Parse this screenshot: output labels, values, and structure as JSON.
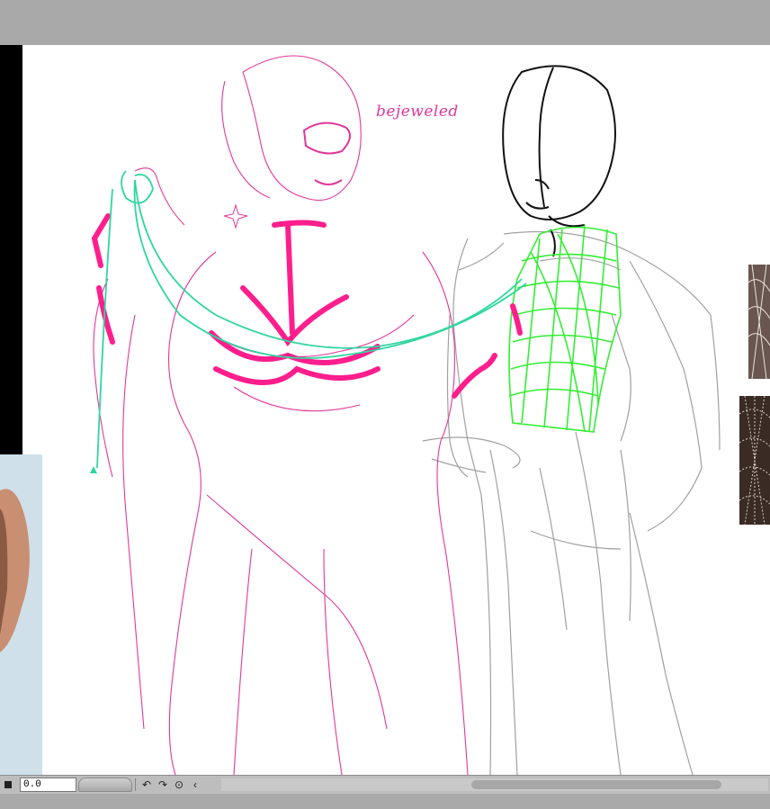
{
  "canvas": {
    "annotation_text": "bejeweled",
    "colors": {
      "background": "#ffffff",
      "pink_sketch": "#e0389a",
      "pink_ink": "#ff1e8c",
      "green_mesh": "#33ee33",
      "teal_chain": "#2fd6a0",
      "gray_sketch": "#9a9a9a",
      "black_ink": "#111111"
    }
  },
  "statusbar": {
    "stop_icon": "stop-icon",
    "zoom_value": "0.0",
    "undo_icon": "undo-icon",
    "redo_icon": "redo-icon",
    "rotate_icon": "rotate-reset-icon",
    "scroll_left_icon": "chevron-left-icon",
    "undo_glyph": "↶",
    "redo_glyph": "↷",
    "rotate_glyph": "⊙",
    "left_glyph": "‹"
  }
}
